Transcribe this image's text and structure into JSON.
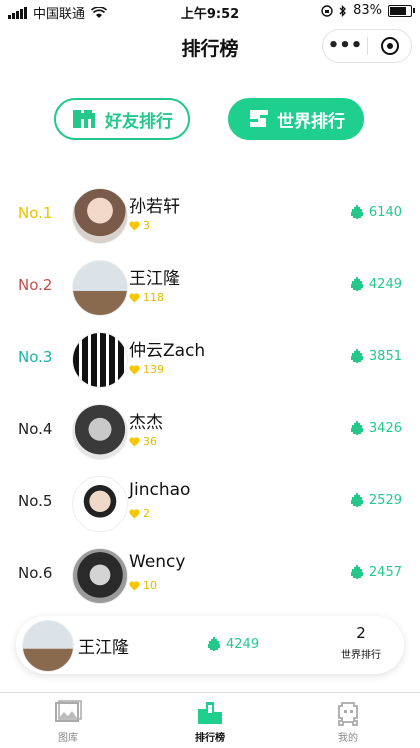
{
  "status_bar": {
    "carrier": "中国联通",
    "time": "上午9:52",
    "battery": "83%"
  },
  "nav": {
    "title": "排行榜",
    "more": "•••"
  },
  "tabs": {
    "friend": "好友排行",
    "world": "世界排行",
    "active": "world"
  },
  "ranking": [
    {
      "rank": "No.1",
      "name": "孙若轩",
      "likes": "3",
      "score": "6140",
      "rank_color": "#e8c300"
    },
    {
      "rank": "No.2",
      "name": "王江隆",
      "likes": "118",
      "score": "4249",
      "rank_color": "#c0504a"
    },
    {
      "rank": "No.3",
      "name": "仲云Zach",
      "likes": "139",
      "score": "3851",
      "rank_color": "#1bb3a8"
    },
    {
      "rank": "No.4",
      "name": "杰杰",
      "likes": "36",
      "score": "3426",
      "rank_color": "#222222"
    },
    {
      "rank": "No.5",
      "name": "Jinchao",
      "likes": "2",
      "score": "2529",
      "rank_color": "#222222"
    },
    {
      "rank": "No.6",
      "name": "Wency",
      "likes": "10",
      "score": "2457",
      "rank_color": "#222222"
    }
  ],
  "my_card": {
    "name": "王江隆",
    "score": "4249",
    "rank": "2",
    "rank_label": "世界排行"
  },
  "tabbar": {
    "gallery": "图库",
    "rank": "排行榜",
    "me": "我的"
  },
  "colors": {
    "accent": "#1fcf8e",
    "like": "#f5c800"
  }
}
